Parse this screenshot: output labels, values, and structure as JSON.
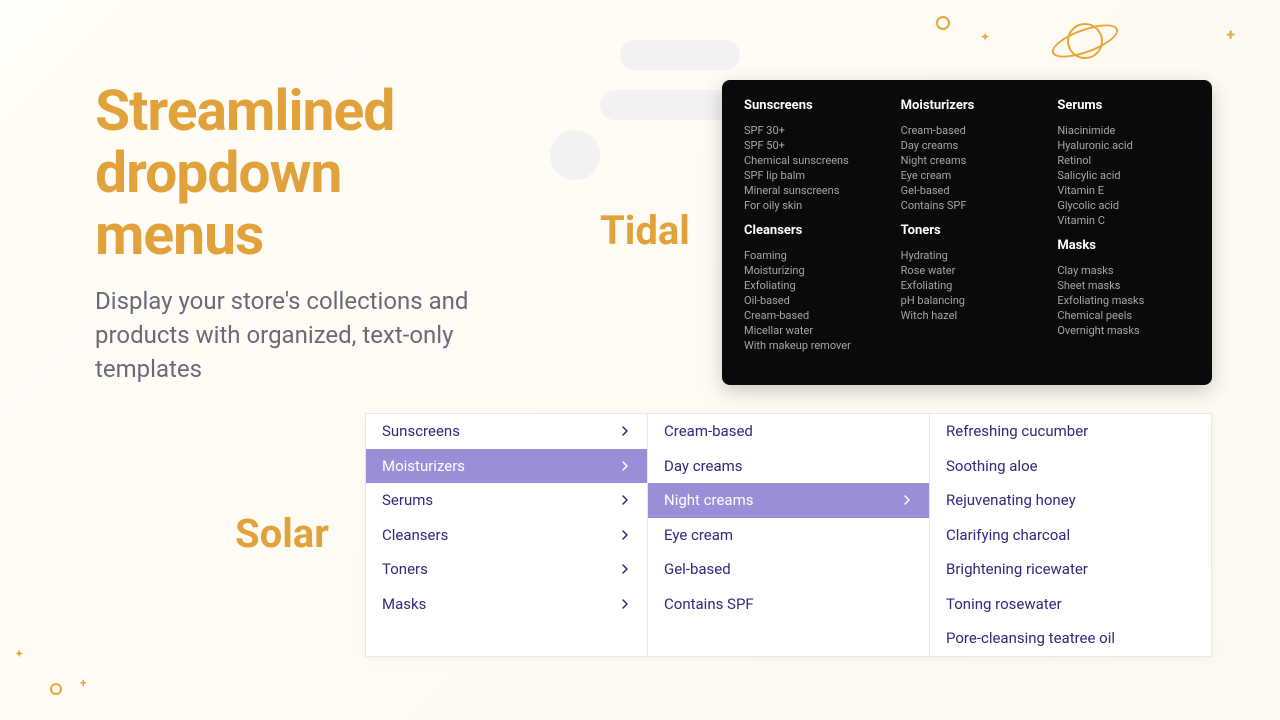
{
  "headline": {
    "title_line1": "Streamlined",
    "title_line2": "dropdown",
    "title_line3": "menus",
    "subtitle": "Display your store's collections and products with organized, text-only templates"
  },
  "labels": {
    "tidal": "Tidal",
    "solar": "Solar"
  },
  "tidal": {
    "columns": [
      {
        "groups": [
          {
            "header": "Sunscreens",
            "items": [
              "SPF 30+",
              "SPF 50+",
              "Chemical sunscreens",
              "SPF lip balm",
              "Mineral sunscreens",
              "For oily skin"
            ]
          },
          {
            "header": "Cleansers",
            "items": [
              "Foaming",
              "Moisturizing",
              "Exfoliating",
              "Oil-based",
              "Cream-based",
              "Micellar water",
              "With makeup remover"
            ]
          }
        ]
      },
      {
        "groups": [
          {
            "header": "Moisturizers",
            "items": [
              "Cream-based",
              "Day creams",
              "Night creams",
              "Eye cream",
              "Gel-based",
              "Contains SPF"
            ]
          },
          {
            "header": "Toners",
            "items": [
              "Hydrating",
              "Rose water",
              "Exfoliating",
              "pH balancing",
              "Witch hazel"
            ]
          }
        ]
      },
      {
        "groups": [
          {
            "header": "Serums",
            "items": [
              "Niacinimide",
              "Hyaluronic acid",
              "Retinol",
              "Salicylic acid",
              "Vitamin E",
              "Glycolic acid",
              "Vitamin C"
            ]
          },
          {
            "header": "Masks",
            "items": [
              "Clay masks",
              "Sheet masks",
              "Exfoliating masks",
              "Chemical peels",
              "Overnight masks"
            ]
          }
        ]
      }
    ]
  },
  "solar": {
    "col1": [
      {
        "label": "Sunscreens",
        "active": false
      },
      {
        "label": "Moisturizers",
        "active": true
      },
      {
        "label": "Serums",
        "active": false
      },
      {
        "label": "Cleansers",
        "active": false
      },
      {
        "label": "Toners",
        "active": false
      },
      {
        "label": "Masks",
        "active": false
      }
    ],
    "col2": [
      {
        "label": "Cream-based",
        "active": false
      },
      {
        "label": "Day creams",
        "active": false
      },
      {
        "label": "Night creams",
        "active": true
      },
      {
        "label": "Eye cream",
        "active": false
      },
      {
        "label": "Gel-based",
        "active": false
      },
      {
        "label": "Contains SPF",
        "active": false
      }
    ],
    "col3": [
      {
        "label": "Refreshing cucumber"
      },
      {
        "label": "Soothing aloe"
      },
      {
        "label": "Rejuvenating honey"
      },
      {
        "label": "Clarifying charcoal"
      },
      {
        "label": "Brightening ricewater"
      },
      {
        "label": "Toning rosewater"
      },
      {
        "label": "Pore-cleansing teatree oil"
      }
    ]
  },
  "colors": {
    "gold": "#e2a23b",
    "purple": "#9a8ed8",
    "darkblue": "#2f2a7b"
  }
}
